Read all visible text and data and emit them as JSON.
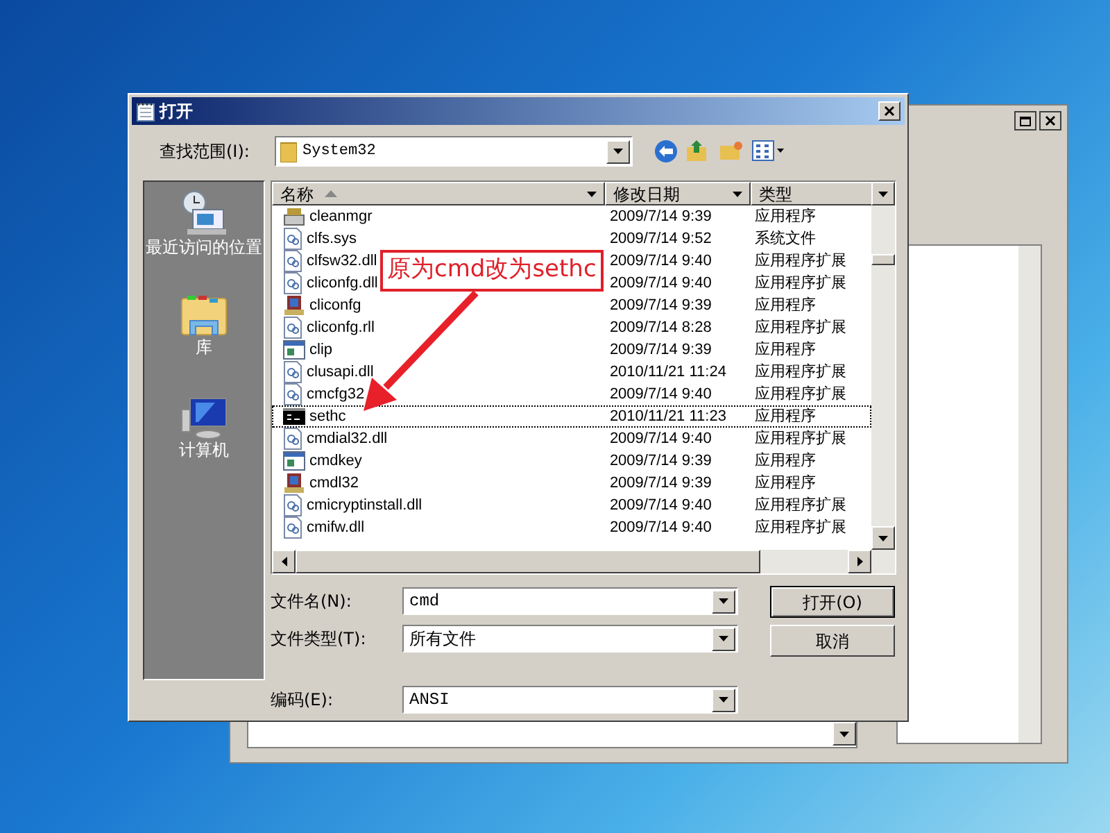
{
  "dialog": {
    "title": "打开",
    "look_in_label": "查找范围(I):",
    "look_in_value": "System32"
  },
  "places": [
    {
      "label": "最近访问的位置",
      "kind": "recent"
    },
    {
      "label": "库",
      "kind": "library"
    },
    {
      "label": "计算机",
      "kind": "computer"
    }
  ],
  "columns": [
    {
      "label": "名称",
      "sorted": true
    },
    {
      "label": "修改日期",
      "sorted": false
    },
    {
      "label": "类型",
      "sorted": false
    }
  ],
  "files": [
    {
      "name": "cleanmgr",
      "date": "2009/7/14 9:39",
      "type": "应用程序",
      "kind": "cleaner",
      "selected": false
    },
    {
      "name": "clfs.sys",
      "date": "2009/7/14 9:52",
      "type": "系统文件",
      "kind": "file",
      "selected": false
    },
    {
      "name": "clfsw32.dll",
      "date": "2009/7/14 9:40",
      "type": "应用程序扩展",
      "kind": "file",
      "selected": false
    },
    {
      "name": "cliconfg.dll",
      "date": "2009/7/14 9:40",
      "type": "应用程序扩展",
      "kind": "file",
      "selected": false
    },
    {
      "name": "cliconfg",
      "date": "2009/7/14 9:39",
      "type": "应用程序",
      "kind": "setup",
      "selected": false
    },
    {
      "name": "cliconfg.rll",
      "date": "2009/7/14 8:28",
      "type": "应用程序扩展",
      "kind": "file",
      "selected": false
    },
    {
      "name": "clip",
      "date": "2009/7/14 9:39",
      "type": "应用程序",
      "kind": "window",
      "selected": false
    },
    {
      "name": "clusapi.dll",
      "date": "2010/11/21 11:24",
      "type": "应用程序扩展",
      "kind": "file",
      "selected": false
    },
    {
      "name": "cmcfg32",
      "date": "2009/7/14 9:40",
      "type": "应用程序扩展",
      "kind": "file",
      "selected": false
    },
    {
      "name": "sethc",
      "date": "2010/11/21 11:23",
      "type": "应用程序",
      "kind": "console",
      "selected": true
    },
    {
      "name": "cmdial32.dll",
      "date": "2009/7/14 9:40",
      "type": "应用程序扩展",
      "kind": "file",
      "selected": false
    },
    {
      "name": "cmdkey",
      "date": "2009/7/14 9:39",
      "type": "应用程序",
      "kind": "window",
      "selected": false
    },
    {
      "name": "cmdl32",
      "date": "2009/7/14 9:39",
      "type": "应用程序",
      "kind": "setup",
      "selected": false
    },
    {
      "name": "cmicryptinstall.dll",
      "date": "2009/7/14 9:40",
      "type": "应用程序扩展",
      "kind": "file",
      "selected": false
    },
    {
      "name": "cmifw.dll",
      "date": "2009/7/14 9:40",
      "type": "应用程序扩展",
      "kind": "file",
      "selected": false
    }
  ],
  "fields": [
    {
      "label": "文件名(N):",
      "value": "cmd"
    },
    {
      "label": "文件类型(T):",
      "value": "所有文件"
    },
    {
      "label": "编码(E):",
      "value": "ANSI"
    }
  ],
  "buttons": [
    "打开(O)",
    "取消"
  ],
  "annotation": "原为cmd改为sethc"
}
